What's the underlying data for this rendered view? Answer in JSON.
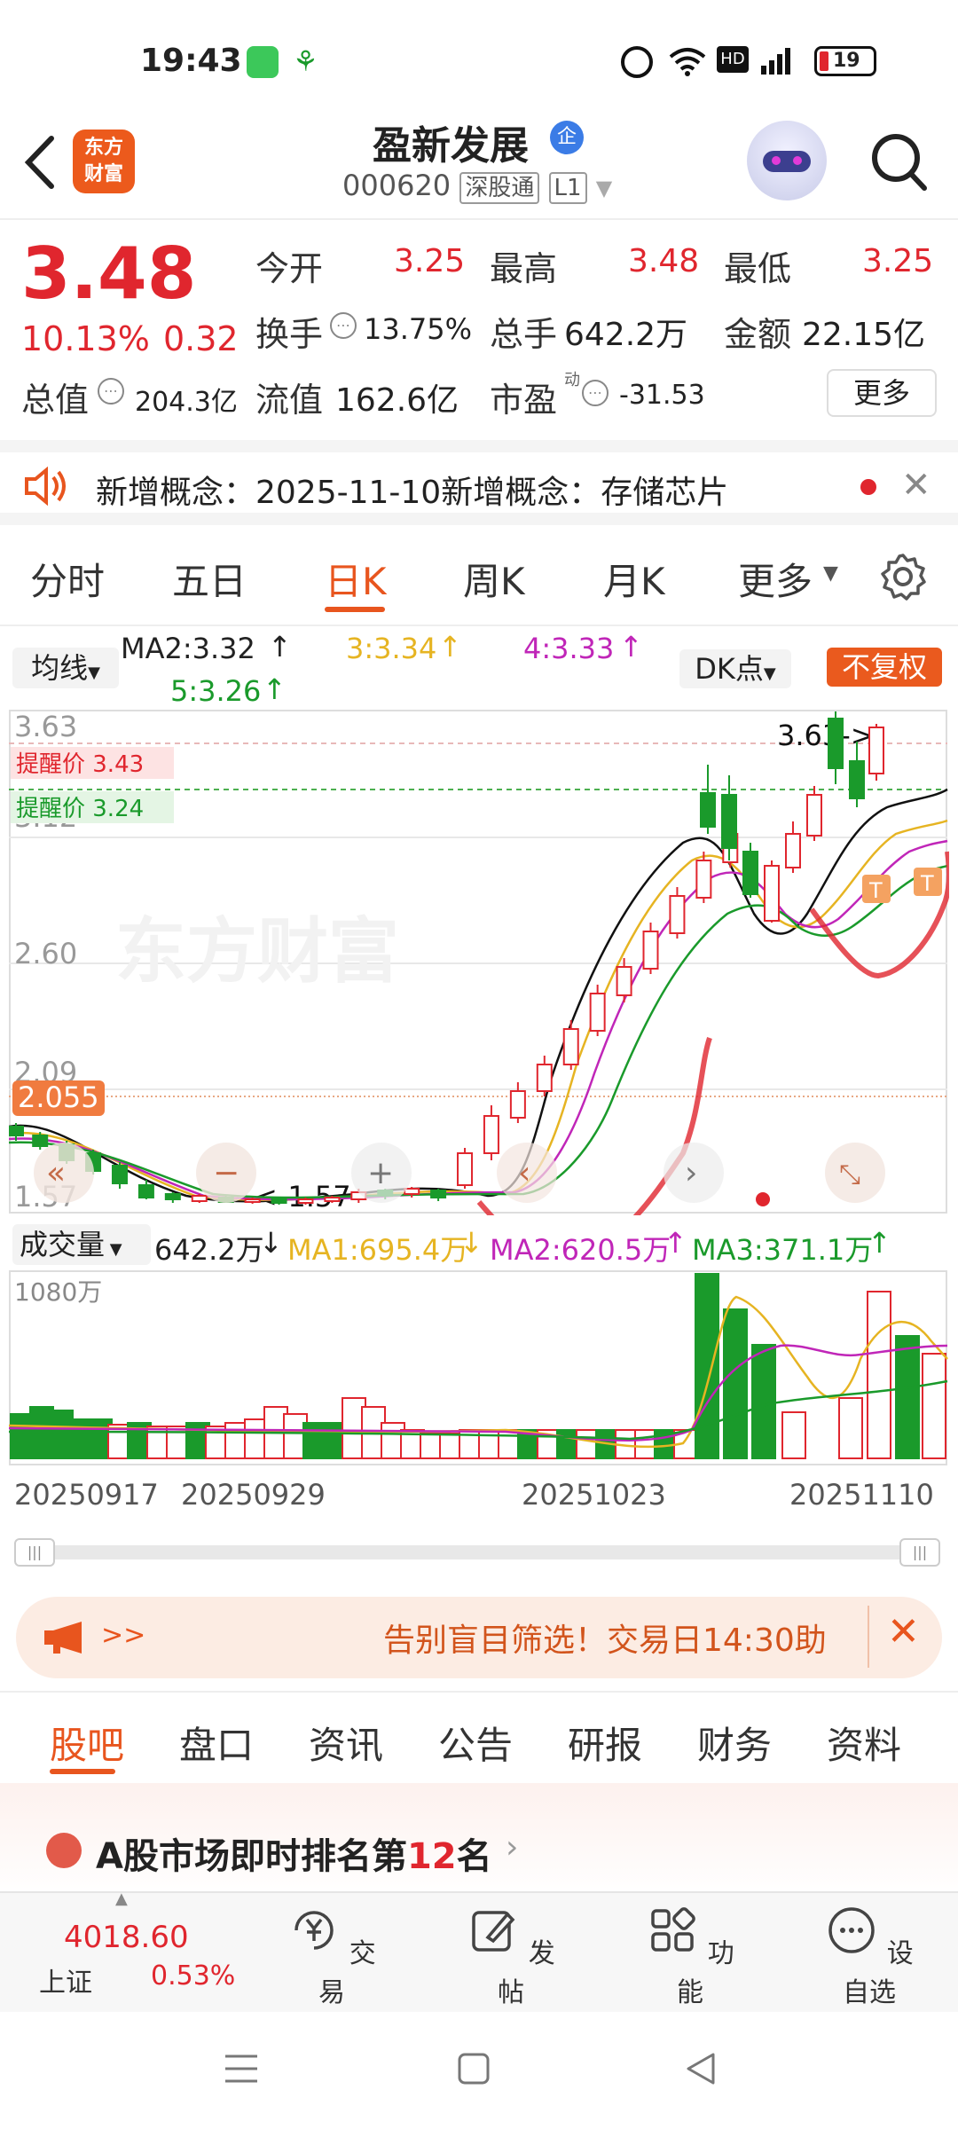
{
  "status_bar": {
    "time": "19:43",
    "battery": "19"
  },
  "header": {
    "logo_line1": "东方",
    "logo_line2": "财富",
    "stock_name": "盈新发展",
    "badge": "企",
    "stock_code": "000620",
    "tag_connect": "深股通",
    "tag_level": "L1"
  },
  "quote": {
    "price": "3.48",
    "change_pct": "10.13%",
    "change_abs": "0.32",
    "open_label": "今开",
    "open": "3.25",
    "high_label": "最高",
    "high": "3.48",
    "low_label": "最低",
    "low": "3.25",
    "turnover_label": "换手",
    "turnover": "13.75%",
    "volume_label": "总手",
    "volume": "642.2万",
    "amount_label": "金额",
    "amount": "22.15亿",
    "mktcap_label": "总值",
    "mktcap": "204.3亿",
    "float_label": "流值",
    "float_cap": "162.6亿",
    "pe_label": "市盈",
    "pe_sup": "动",
    "pe": "-31.53",
    "more": "更多"
  },
  "notice": {
    "text": "新增概念：2025-11-10新增概念：存储芯片"
  },
  "kline_tabs": {
    "items": [
      "分时",
      "五日",
      "日K",
      "周K",
      "月K",
      "更多"
    ],
    "active": 2
  },
  "ma_legend": {
    "junxian": "均线",
    "ma2": "MA2:3.32",
    "ma3": "3:3.34",
    "ma4": "4:3.33",
    "ma5": "5:3.26",
    "dk": "DK点",
    "fuquan": "不复权"
  },
  "chart_labels": {
    "y_363": "3.63",
    "y_312": "3.12",
    "y_260": "2.60",
    "y_209": "2.09",
    "y_157": "1.57",
    "marker_2055": "2.055",
    "alert_high": "提醒价 3.43",
    "alert_low": "提醒价 3.24",
    "max_note": "3.63->",
    "min_note": "<-1.57",
    "watermark": "东方财富"
  },
  "volume_legend": {
    "label": "成交量",
    "value": "642.2万",
    "ma1": "MA1:695.4万",
    "ma2": "MA2:620.5万",
    "ma3": "MA3:371.1万",
    "max": "1080万"
  },
  "x_dates": [
    "20250917",
    "20250929",
    "20251023",
    "20251110"
  ],
  "colors": {
    "up": "#e0262e",
    "down": "#1a9a2b",
    "accent": "#e8551e",
    "ma1": "#e6b422",
    "ma2": "#c026b8",
    "ma3": "#1a9a2b"
  },
  "banner": {
    "arrows": ">>",
    "text": "告别盲目筛选！交易日14:30助"
  },
  "bottom_tabs": {
    "items": [
      "股吧",
      "盘口",
      "资讯",
      "公告",
      "研报",
      "财务",
      "资料"
    ],
    "active": 0
  },
  "rank": {
    "prefix": "A股市场即时排名第",
    "num": "12",
    "suffix": "名"
  },
  "bottom_nav": {
    "index_value": "4018.60",
    "index_name": "上证",
    "index_change": "0.53%",
    "trade": "交易",
    "post": "发帖",
    "func": "功能",
    "watch": "设自选"
  }
}
